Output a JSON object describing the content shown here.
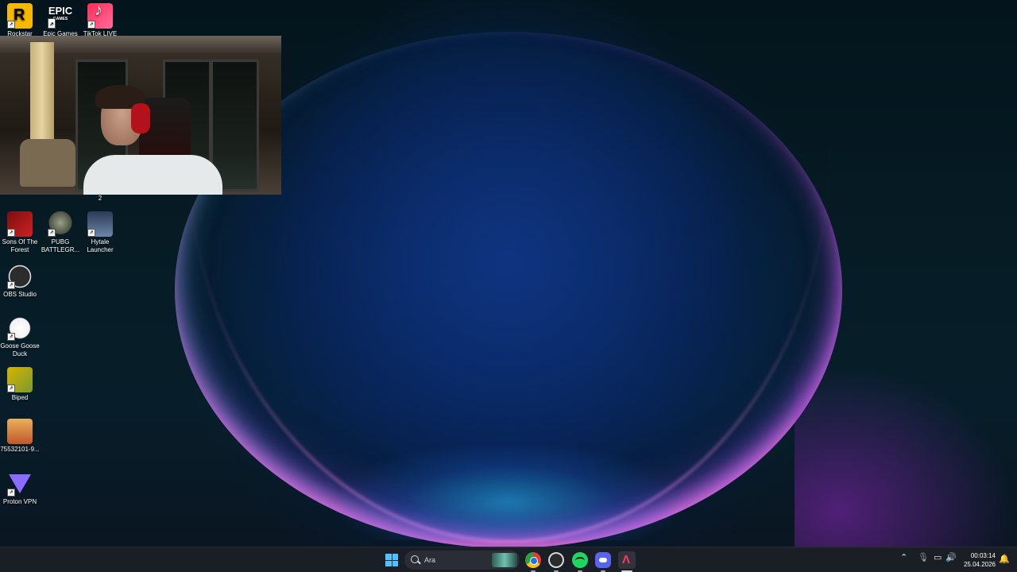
{
  "desktop": {
    "icons_top": [
      {
        "label": "Rockstar",
        "icon": "rockstar-icon"
      },
      {
        "label": "Epic Games",
        "icon": "epic-games-icon",
        "logo_text_1": "EPIC",
        "logo_text_2": "GAMES"
      },
      {
        "label": "TikTok LIVE",
        "icon": "tiktok-live-icon"
      }
    ],
    "icons": [
      {
        "label": "Sons Of The Forest",
        "icon": "sons-of-the-forest-icon"
      },
      {
        "label": "PUBG BATTLEGR...",
        "icon": "pubg-icon"
      },
      {
        "label": "Hytale Launcher",
        "icon": "hytale-launcher-icon"
      },
      {
        "label": "OBS Studio",
        "icon": "obs-studio-icon"
      },
      {
        "label": "Goose Goose Duck",
        "icon": "goose-goose-duck-icon"
      },
      {
        "label": "Biped",
        "icon": "biped-icon"
      },
      {
        "label": "75532101-9...",
        "icon": "image-file-icon"
      },
      {
        "label": "Proton VPN",
        "icon": "proton-vpn-icon"
      }
    ],
    "webcam_caption": "2"
  },
  "taskbar": {
    "search_placeholder": "Ara",
    "apps": [
      "windows-start-icon",
      "chrome-icon",
      "obs-icon",
      "spotify-icon",
      "discord-icon",
      "active-app-icon"
    ],
    "clock_time": "00:03:14",
    "clock_date": "25.04.2026"
  },
  "colors": {
    "taskbar_bg": "#1c2026",
    "accent": "#4cc2ff"
  }
}
